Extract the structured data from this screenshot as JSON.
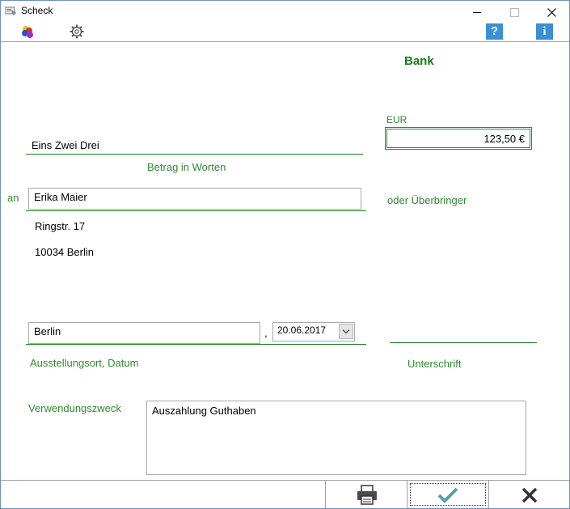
{
  "window": {
    "title": "Scheck",
    "minimize": "—",
    "maximize": "☐",
    "close": "✕"
  },
  "toolbar": {
    "icons": [
      "colors-icon",
      "settings-gear-icon",
      "help-icon",
      "info-icon"
    ],
    "help_glyph": "?",
    "info_glyph": "i"
  },
  "check": {
    "bank_label": "Bank",
    "currency_label": "EUR",
    "amount_value": "123,50 €",
    "amount_words_value": "Eins Zwei Drei",
    "amount_words_caption": "Betrag in Worten",
    "payee_prefix": "an",
    "payee_value": "Erika Maier",
    "bearer_label": "oder Überbringer",
    "address_line1": "Ringstr. 17",
    "address_line2": "10034 Berlin",
    "place_value": "Berlin",
    "comma": ",",
    "date_value": "20.06.2017",
    "place_date_caption": "Ausstellungsort, Datum",
    "signature_caption": "Unterschrift",
    "purpose_label": "Verwendungszweck",
    "purpose_value": "Auszahlung Guthaben"
  },
  "footer": {
    "buttons": [
      "print-button",
      "ok-button",
      "cancel-button"
    ]
  },
  "colors": {
    "accent_green": "#2e8b2e",
    "bank_green": "#1a7a1a",
    "help_blue": "#3b8fd6"
  }
}
